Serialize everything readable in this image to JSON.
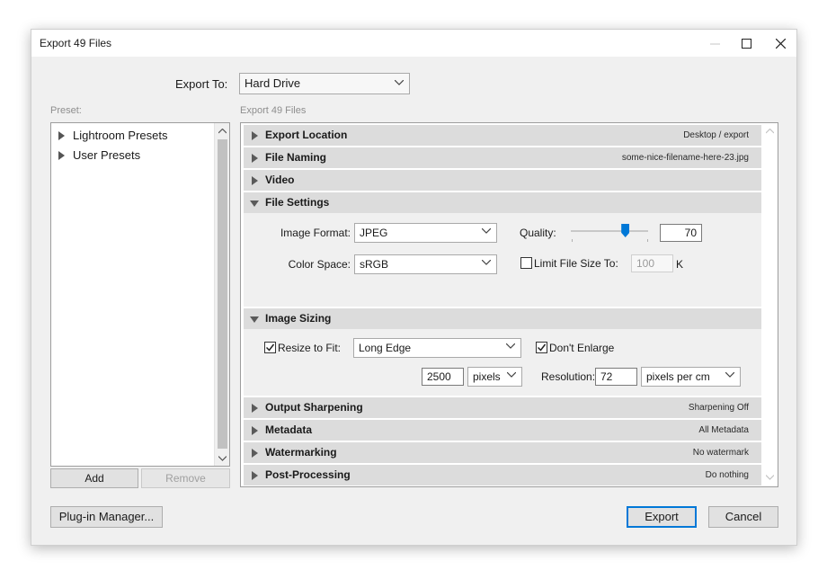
{
  "window": {
    "title": "Export 49 Files"
  },
  "export_to": {
    "label": "Export To:",
    "value": "Hard Drive"
  },
  "preset": {
    "label": "Preset:",
    "items": [
      "Lightroom Presets",
      "User Presets"
    ],
    "add_label": "Add",
    "remove_label": "Remove"
  },
  "panel_label": "Export 49 Files",
  "sections": {
    "export_location": {
      "name": "Export Location",
      "summary": "Desktop / export"
    },
    "file_naming": {
      "name": "File Naming",
      "summary": "some-nice-filename-here-23.jpg"
    },
    "video": {
      "name": "Video",
      "summary": ""
    },
    "file_settings": {
      "name": "File Settings",
      "image_format_label": "Image Format:",
      "image_format": "JPEG",
      "quality_label": "Quality:",
      "quality": "70",
      "quality_fraction": 0.7,
      "color_space_label": "Color Space:",
      "color_space": "sRGB",
      "limit_label": "Limit File Size To:",
      "limit_checked": false,
      "limit_value": "100",
      "limit_unit": "K"
    },
    "image_sizing": {
      "name": "Image Sizing",
      "resize_label": "Resize to Fit:",
      "resize_checked": true,
      "resize_mode": "Long Edge",
      "dont_enlarge_label": "Don't Enlarge",
      "dont_enlarge_checked": true,
      "size_value": "2500",
      "size_unit": "pixels",
      "resolution_label": "Resolution:",
      "resolution_value": "72",
      "resolution_unit": "pixels per cm"
    },
    "output_sharpening": {
      "name": "Output Sharpening",
      "summary": "Sharpening Off"
    },
    "metadata": {
      "name": "Metadata",
      "summary": "All Metadata"
    },
    "watermarking": {
      "name": "Watermarking",
      "summary": "No watermark"
    },
    "post_processing": {
      "name": "Post-Processing",
      "summary": "Do nothing"
    }
  },
  "buttons": {
    "plugin_manager": "Plug-in Manager...",
    "export": "Export",
    "cancel": "Cancel"
  },
  "icons": {
    "minimize": "minimize-icon",
    "maximize": "maximize-icon",
    "close": "close-icon",
    "chevron": "chevron-down-icon",
    "expand": "triangle-right-icon",
    "collapse": "triangle-down-icon"
  },
  "colors": {
    "accent": "#0078d7",
    "section_header": "#dcdcdc",
    "dialog_bg": "#f0f0f0"
  }
}
